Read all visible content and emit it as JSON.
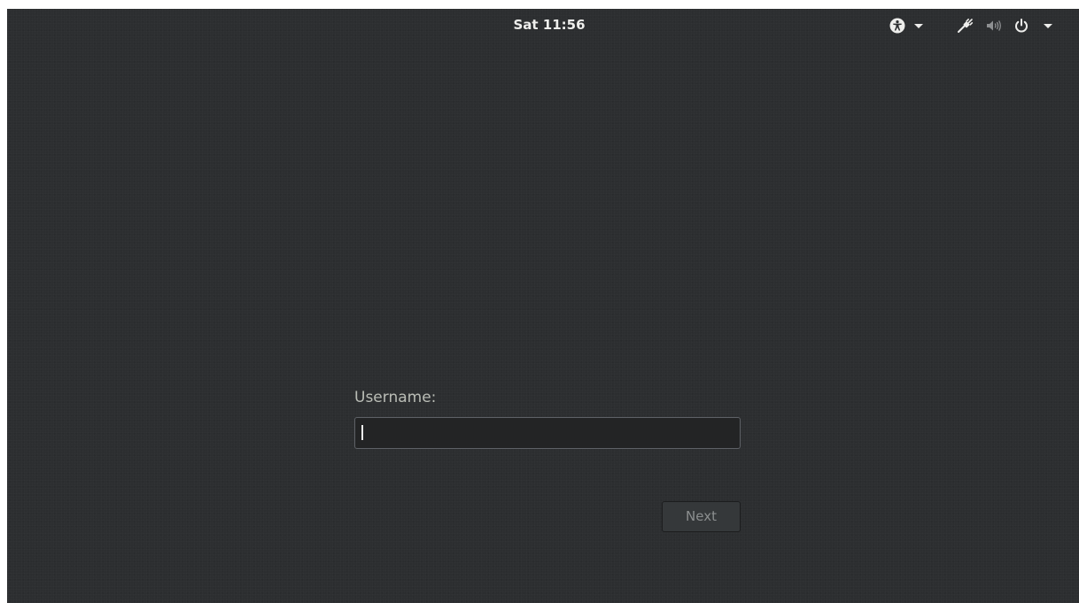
{
  "top_bar": {
    "clock": "Sat 11:56",
    "accessibility_icon": "accessibility-icon",
    "network_icon": "network-wired-icon",
    "volume_icon": "volume-icon",
    "power_icon": "power-icon",
    "menu_arrow_icon": "chevron-down-icon"
  },
  "login": {
    "username_label": "Username:",
    "username_value": "",
    "next_label": "Next"
  },
  "colors": {
    "background": "#2c2e30",
    "text": "#eeeeec",
    "label": "#babdb6",
    "entry_background": "#232425",
    "button_disabled_text": "#8b8e8f"
  }
}
